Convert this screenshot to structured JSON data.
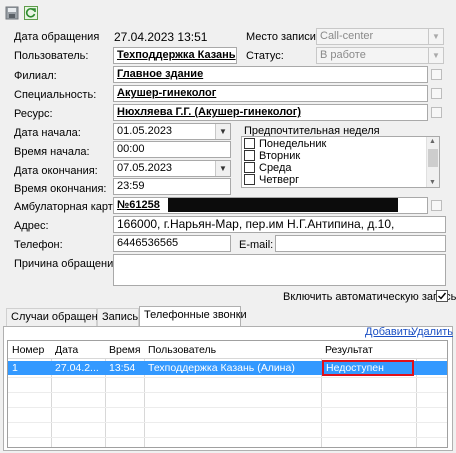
{
  "toolbar": {
    "save_icon": "floppy-disk-icon",
    "refresh_icon": "refresh-icon"
  },
  "form": {
    "date_label": "Дата обращения",
    "date_value": "27.04.2023 13:51",
    "source_label": "Место записи:",
    "source_value": "Call-center",
    "user_label": "Пользователь:",
    "user_value": "Техподдержка Казань",
    "status_label": "Статус:",
    "status_value": "В работе",
    "branch_label": "Филиал:",
    "branch_value": "Главное здание",
    "specialty_label": "Специальность:",
    "specialty_value": "Акушер-гинеколог",
    "resource_label": "Ресурс:",
    "resource_value": "Нюхляева Г.Г. (Акушер-гинеколог)",
    "start_date_label": "Дата начала:",
    "start_date_value": "01.05.2023",
    "start_time_label": "Время начала:",
    "start_time_value": "00:00",
    "end_date_label": "Дата окончания:",
    "end_date_value": "07.05.2023",
    "end_time_label": "Время окончания:",
    "end_time_value": "23:59",
    "week_label": "Предпочтительная неделя",
    "week_days": [
      "Понедельник",
      "Вторник",
      "Среда",
      "Четверг"
    ],
    "card_label": "Амбулаторная карта:",
    "card_value": "№61258",
    "address_label": "Адрес:",
    "address_value": "166000, г.Нарьян-Мар, пер.им Н.Г.Антипина, д.10,",
    "phone_label": "Телефон:",
    "phone_value": "6446536565",
    "email_label": "E-mail:",
    "email_value": "",
    "reason_label": "Причина обращения:",
    "reason_value": "",
    "auto_record_label": "Включить автоматическую запись"
  },
  "tabs": [
    {
      "label": "Случаи обращения"
    },
    {
      "label": "Запись"
    },
    {
      "label": "Телефонные звонки"
    }
  ],
  "actions": {
    "add_label": "Добавить",
    "delete_label": "Удалить"
  },
  "calls_table": {
    "columns": [
      "Номер",
      "Дата",
      "Время",
      "Пользователь",
      "Результат"
    ],
    "rows": [
      {
        "number": "1",
        "date": "27.04.2...",
        "time": "13:54",
        "user": "Техподдержка Казань (Алина)",
        "result": "Недоступен"
      }
    ]
  },
  "colors": {
    "selection": "#3399ff",
    "highlight_border": "#e0101a",
    "link": "#1a4fc4"
  }
}
